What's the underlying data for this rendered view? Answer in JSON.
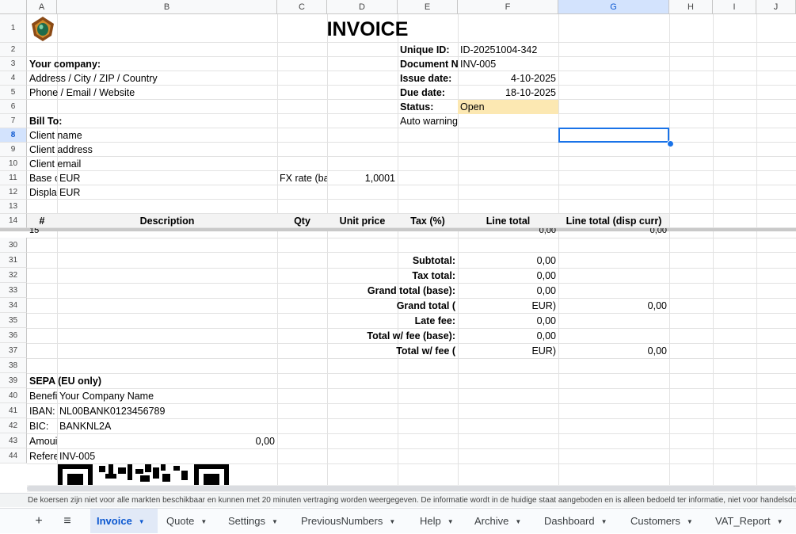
{
  "columns": [
    "A",
    "B",
    "C",
    "D",
    "E",
    "F",
    "G",
    "H",
    "I",
    "J"
  ],
  "selected_column": "G",
  "top_rows": [
    "1",
    "2",
    "3",
    "4",
    "5",
    "6",
    "7",
    "8",
    "9",
    "10",
    "11",
    "12",
    "13",
    "14"
  ],
  "bottom_rows": [
    "30",
    "31",
    "32",
    "33",
    "34",
    "35",
    "36",
    "37",
    "38",
    "39",
    "40",
    "41",
    "42",
    "43",
    "44"
  ],
  "selected_row": "8",
  "title": "INVOICE",
  "company": {
    "label": "Your company:",
    "address": "Address / City / ZIP / Country",
    "contact": "Phone / Email / Website"
  },
  "meta": {
    "unique_id_label": "Unique ID:",
    "unique_id": "ID-20251004-342",
    "doc_no_label": "Document No",
    "doc_no": "INV-005",
    "issue_label": "Issue date:",
    "issue_date": "4-10-2025",
    "due_label": "Due date:",
    "due_date": "18-10-2025",
    "status_label": "Status:",
    "status": "Open",
    "auto_warning": "Auto warning"
  },
  "bill_to": {
    "label": "Bill To:",
    "name": "Client name",
    "address": "Client address",
    "email": "Client email"
  },
  "currency": {
    "base_label": "Base c",
    "base": "EUR",
    "fx_label": "FX rate (bas",
    "fx": "1,0001",
    "disp_label": "Displa",
    "disp": "EUR"
  },
  "table_headers": [
    "#",
    "Description",
    "Qty",
    "Unit price",
    "Tax (%)",
    "Line total",
    "Line total (disp curr)"
  ],
  "partial_row": {
    "num": "15",
    "total": "0,00",
    "disp_total": "0,00"
  },
  "totals": {
    "subtotal_label": "Subtotal:",
    "subtotal": "0,00",
    "tax_label": "Tax total:",
    "tax": "0,00",
    "grand_base_label": "Grand total (base):",
    "grand_base": "0,00",
    "grand_disp_label": "Grand total (",
    "grand_disp_cur": "EUR)",
    "grand_disp": "0,00",
    "late_fee_label": "Late fee:",
    "late_fee": "0,00",
    "total_fee_base_label": "Total w/ fee (base):",
    "total_fee_base": "0,00",
    "total_fee_disp_label": "Total w/ fee (",
    "total_fee_disp_cur": "EUR)",
    "total_fee_disp": "0,00"
  },
  "sepa": {
    "label": "SEPA (EU only)",
    "beneficiary_label": "Benefi",
    "beneficiary": "Your Company Name",
    "iban_label": "IBAN:",
    "iban": "NL00BANK0123456789",
    "bic_label": "BIC:",
    "bic": "BANKNL2A",
    "amount_label": "Amoui",
    "amount": "0,00",
    "reference_label": "Refere",
    "reference": "INV-005"
  },
  "footer_note": "De koersen zijn niet voor alle markten beschikbaar en kunnen met 20 minuten vertraging worden weergegeven. De informatie wordt in de huidige staat aangeboden en is alleen bedoeld ter informatie, niet voor handelsdoeleinden.",
  "tabs": [
    "Invoice",
    "Quote",
    "Settings",
    "PreviousNumbers",
    "Help",
    "Archive",
    "Dashboard",
    "Customers",
    "VAT_Report"
  ],
  "active_tab": "Invoice",
  "colors": {
    "status_bg": "#fce8b2",
    "selection": "#1a73e8",
    "active_tab_bg": "#e1e9f7"
  },
  "icons": [
    "add-sheet-icon",
    "all-sheets-icon",
    "logo-icon",
    "qr-code-icon"
  ]
}
